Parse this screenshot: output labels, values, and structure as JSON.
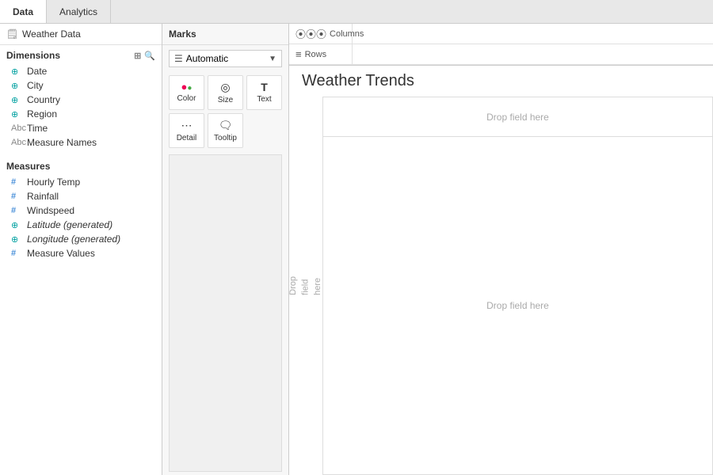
{
  "tabs": {
    "data_label": "Data",
    "analytics_label": "Analytics"
  },
  "datasource": {
    "name": "Weather Data"
  },
  "dimensions": {
    "title": "Dimensions",
    "fields": [
      {
        "id": "date",
        "label": "Date",
        "icon": "globe"
      },
      {
        "id": "city",
        "label": "City",
        "icon": "globe"
      },
      {
        "id": "country",
        "label": "Country",
        "icon": "globe"
      },
      {
        "id": "region",
        "label": "Region",
        "icon": "globe"
      },
      {
        "id": "time",
        "label": "Time",
        "icon": "abc"
      },
      {
        "id": "measure-names",
        "label": "Measure Names",
        "icon": "abc"
      }
    ]
  },
  "measures": {
    "title": "Measures",
    "fields": [
      {
        "id": "hourly-temp",
        "label": "Hourly Temp",
        "icon": "hash"
      },
      {
        "id": "rainfall",
        "label": "Rainfall",
        "icon": "hash"
      },
      {
        "id": "windspeed",
        "label": "Windspeed",
        "icon": "hash"
      },
      {
        "id": "latitude",
        "label": "Latitude (generated)",
        "icon": "globe-green"
      },
      {
        "id": "longitude",
        "label": "Longitude (generated)",
        "icon": "globe-green"
      },
      {
        "id": "measure-values",
        "label": "Measure Values",
        "icon": "hash"
      }
    ]
  },
  "marks": {
    "title": "Marks",
    "dropdown_value": "Automatic",
    "buttons": [
      {
        "id": "color",
        "label": "Color",
        "icon": "●●"
      },
      {
        "id": "size",
        "label": "Size",
        "icon": "◎"
      },
      {
        "id": "text",
        "label": "Text",
        "icon": "T"
      },
      {
        "id": "detail",
        "label": "Detail",
        "icon": "…"
      },
      {
        "id": "tooltip",
        "label": "Tooltip",
        "icon": "💬"
      }
    ]
  },
  "canvas": {
    "columns_label": "Columns",
    "rows_label": "Rows",
    "chart_title": "Weather Trends",
    "drop_field_left": "Drop\nfield\nhere",
    "drop_field_top": "Drop field here",
    "drop_field_center": "Drop field here"
  }
}
